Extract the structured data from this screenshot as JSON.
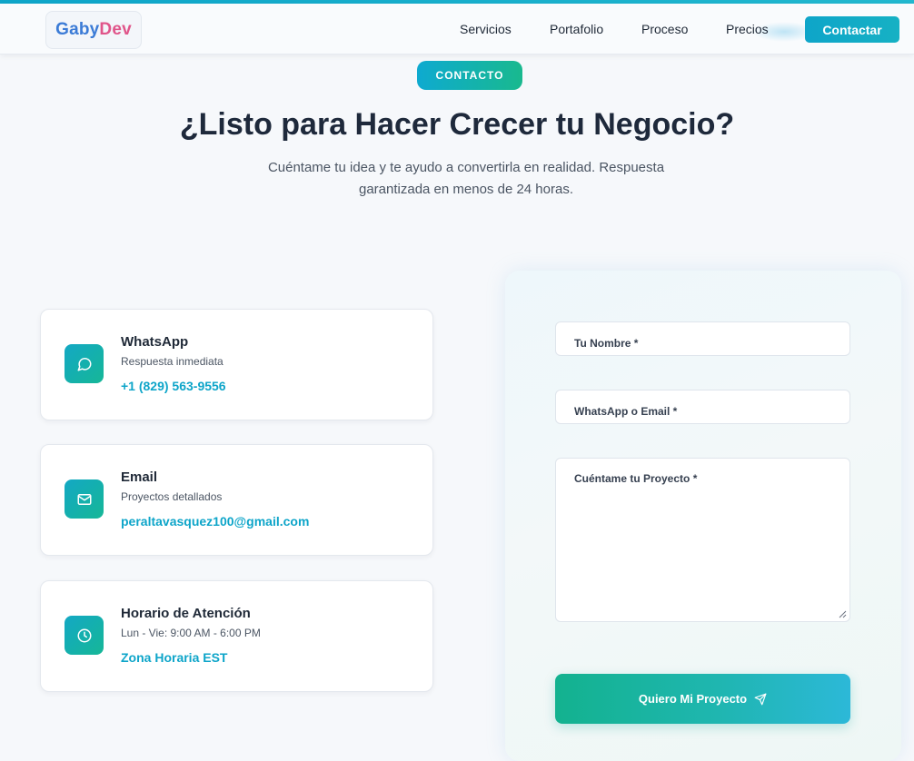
{
  "header": {
    "logo_part1": "Gaby",
    "logo_part2": "Dev",
    "nav_items": [
      "Servicios",
      "Portafolio",
      "Proceso",
      "Precios"
    ],
    "cta_label": "Contactar"
  },
  "hero": {
    "badge": "CONTACTO",
    "title": "¿Listo para Hacer Crecer tu Negocio?",
    "subtitle_line1": "Cuéntame tu idea y te ayudo a convertirla en realidad. Respuesta",
    "subtitle_line2": "garantizada en menos de 24 horas."
  },
  "contact_cards": [
    {
      "icon": "chat-bubble-icon",
      "title": "WhatsApp",
      "description": "Respuesta inmediata",
      "value": "+1 (829) 563-9556"
    },
    {
      "icon": "mail-icon",
      "title": "Email",
      "description": "Proyectos detallados",
      "value": "peraltavasquez100@gmail.com"
    },
    {
      "icon": "clock-icon",
      "title": "Horario de Atención",
      "description": "Lun - Vie: 9:00 AM - 6:00 PM",
      "value": "Zona Horaria EST"
    }
  ],
  "form": {
    "name_label": "Tu Nombre *",
    "contact_label": "WhatsApp o Email *",
    "project_label": "Cuéntame tu Proyecto *",
    "submit_label": "Quiero Mi Proyecto",
    "submit_icon": "send-icon"
  },
  "colors": {
    "accent": "#0ea5c9",
    "accent_green": "#16b797",
    "logo_blue": "#3b7bd6",
    "logo_pink": "#e0558a",
    "heading": "#1e293b"
  }
}
